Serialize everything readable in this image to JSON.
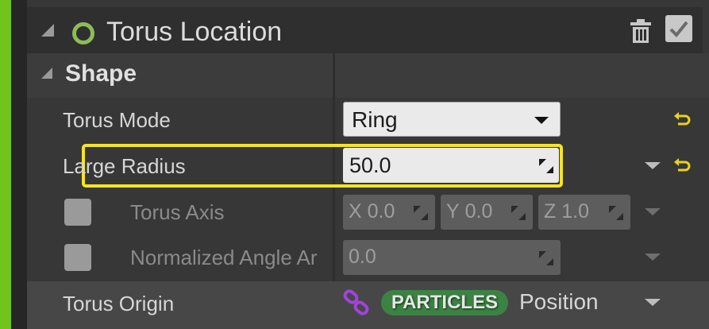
{
  "header": {
    "title": "Torus Location",
    "module_icon": "ring-icon",
    "delete_icon": "trash-icon",
    "enabled_icon": "checkmark-icon",
    "enabled": true
  },
  "section": {
    "title": "Shape",
    "expanded": true
  },
  "rows": {
    "torus_mode": {
      "label": "Torus Mode",
      "value": "Ring"
    },
    "large_radius": {
      "label": "Large Radius",
      "value": "50.0",
      "highlighted": true
    },
    "torus_axis": {
      "label": "Torus Axis",
      "enabled": false,
      "x_label": "X",
      "x_value": "0.0",
      "y_label": "Y",
      "y_value": "0.0",
      "z_label": "Z",
      "z_value": "1.0"
    },
    "normalized_angle": {
      "label": "Normalized Angle Ar",
      "value": "0.0",
      "enabled": false
    },
    "torus_origin": {
      "label": "Torus Origin",
      "namespace": "PARTICLES",
      "value": "Position"
    }
  },
  "colors": {
    "accent_green": "#71c31e",
    "highlight_yellow": "#f4e428",
    "reset_yellow": "#e8d21c",
    "particles_pill": "#3c8244",
    "link_purple": "#a044d8"
  }
}
